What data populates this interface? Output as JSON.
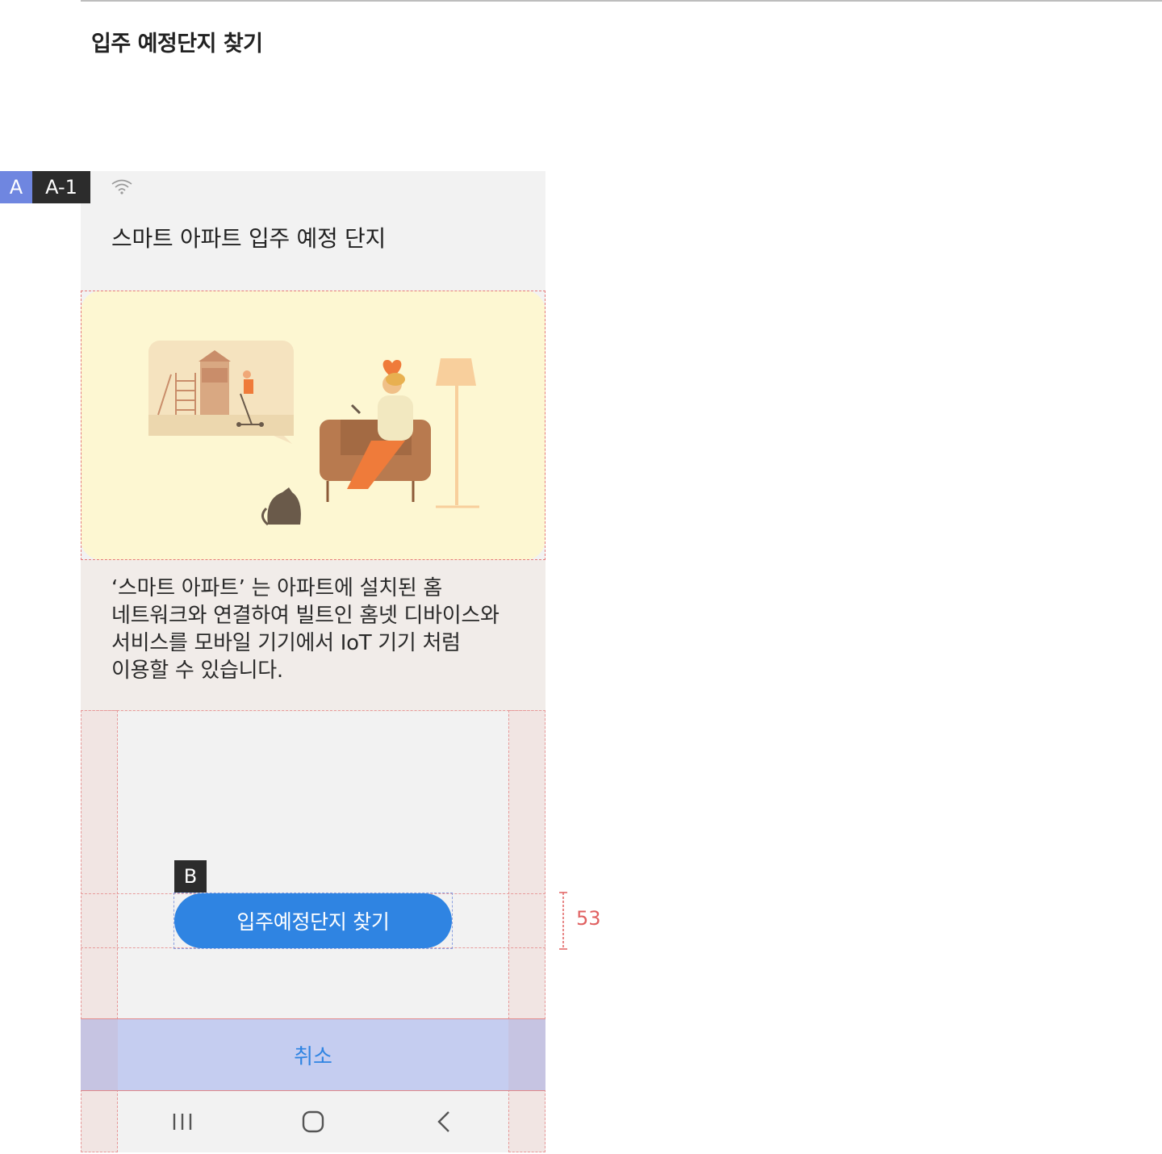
{
  "page": {
    "title": "입주 예정단지 찾기"
  },
  "tags": {
    "a": "A",
    "a1": "A-1",
    "b": "B"
  },
  "app": {
    "header_title": "스마트 아파트 입주 예정 단지",
    "description": "‘스마트 아파트’ 는 아파트에 설치된 홈 네트워크와 연결하여 빌트인 홈넷 디바이스와 서비스를 모바일 기기에서 IoT 기기 처럼 이용할 수 있습니다.",
    "primary_button": "입주예정단지 찾기",
    "cancel_button": "취소"
  },
  "nav": [
    "recent-apps-icon",
    "home-icon",
    "back-icon"
  ],
  "annotation": {
    "height_label": "53"
  },
  "colors": {
    "primary": "#2f84e2",
    "illustration_bg": "#fdf7d2",
    "desc_bg": "#f1ece9",
    "guide": "#e79a9a",
    "tag_a": "#6f86e0"
  }
}
